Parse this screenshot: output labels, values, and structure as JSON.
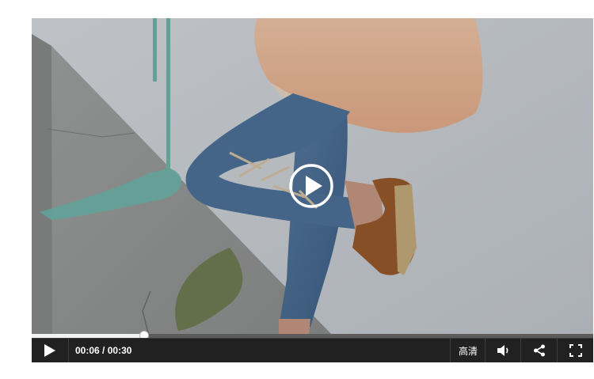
{
  "player": {
    "progress_fraction": 0.2,
    "current_time": "00:06",
    "separator": " / ",
    "total_time": "00:30",
    "quality_label": "高清",
    "icons": {
      "overlay": "play-circle-icon",
      "play": "play-icon",
      "volume": "volume-icon",
      "share": "share-icon",
      "fullscreen": "fullscreen-icon"
    },
    "colors": {
      "control_bar": "#212121",
      "progress_fill": "#f2f2f2",
      "progress_track": "#5c5c5c"
    }
  }
}
